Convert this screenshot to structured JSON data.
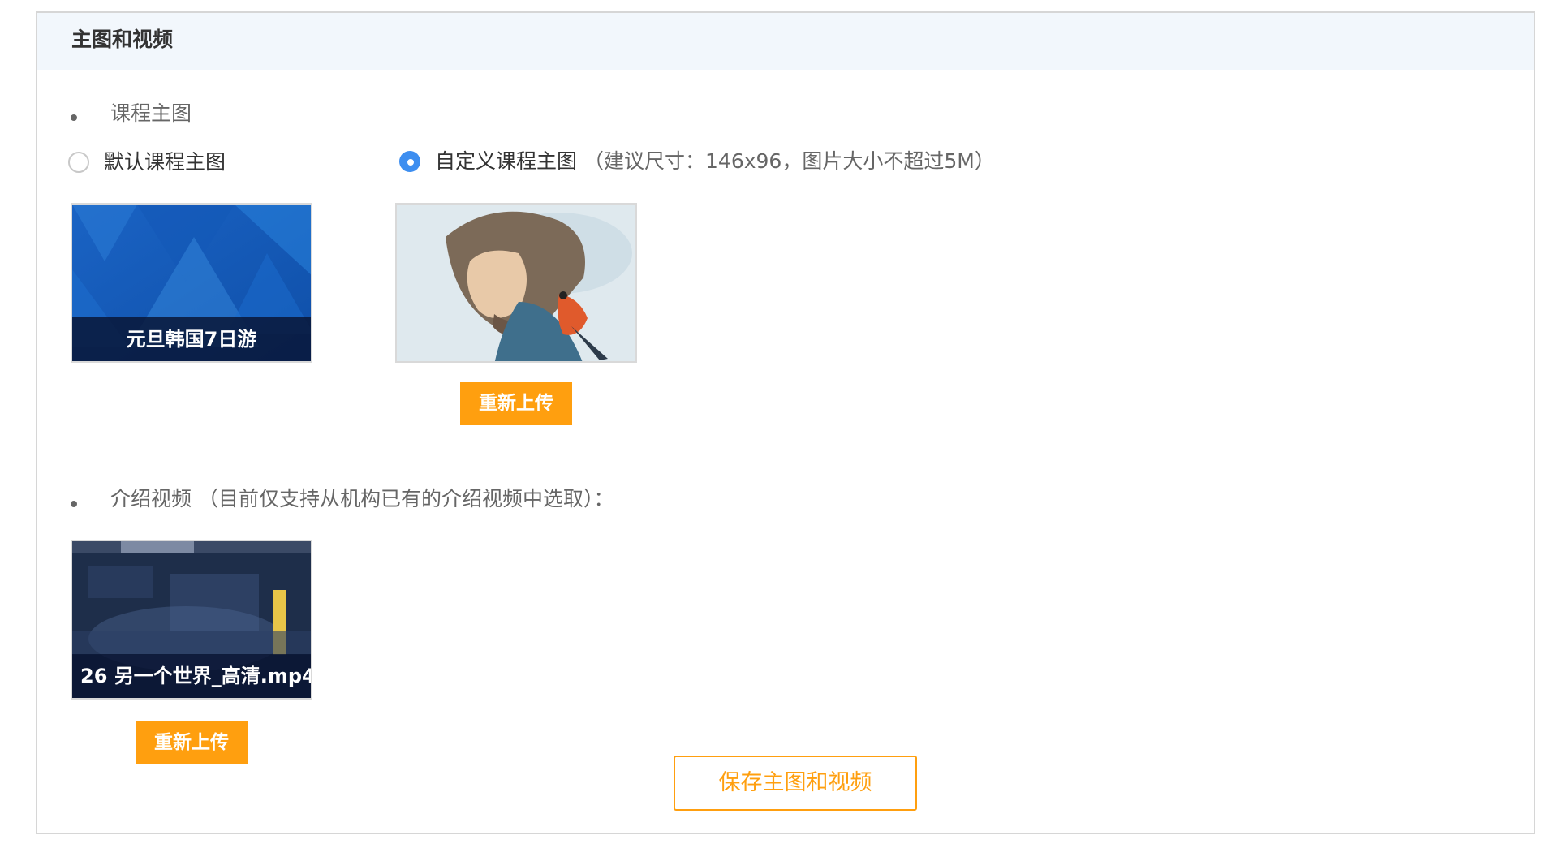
{
  "panel": {
    "title": "主图和视频"
  },
  "course_image": {
    "section_label": "课程主图",
    "options": [
      {
        "label": "默认课程主图",
        "hint": "",
        "checked": false
      },
      {
        "label": "自定义课程主图",
        "hint": "（建议尺寸：146x96，图片大小不超过5M）",
        "checked": true
      }
    ],
    "default_thumb_caption": "元旦韩国7日游",
    "reupload_label": "重新上传"
  },
  "intro_video": {
    "section_label": "介绍视频 （目前仅支持从机构已有的介绍视频中选取）：",
    "thumb_caption": "26 另一个世界_高清.mp4",
    "reupload_label": "重新上传"
  },
  "save_button": {
    "label": "保存主图和视频"
  },
  "colors": {
    "accent_orange": "#ff9f0f",
    "radio_blue": "#3d8ef0",
    "header_bg": "#f2f7fc"
  }
}
